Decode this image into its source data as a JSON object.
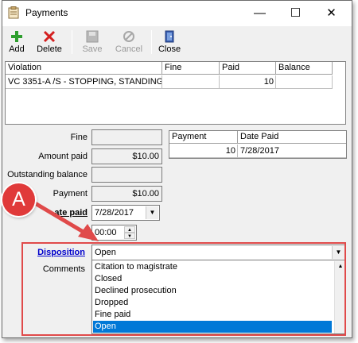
{
  "window": {
    "title": "Payments"
  },
  "window_controls": {
    "minimize": "—",
    "maximize": "☐",
    "close": "✕"
  },
  "toolbar": {
    "add": "Add",
    "delete": "Delete",
    "save": "Save",
    "cancel": "Cancel",
    "close": "Close"
  },
  "violations": {
    "headers": [
      "Violation",
      "Fine",
      "Paid",
      "Balance"
    ],
    "rows": [
      {
        "violation": "VC 3351-A /S - STOPPING, STANDING",
        "fine": "",
        "paid": "10",
        "balance": ""
      }
    ]
  },
  "form": {
    "fine_label": "Fine",
    "fine_value": "",
    "amount_paid_label": "Amount paid",
    "amount_paid_value": "$10.00",
    "outstanding_label": "Outstanding balance",
    "outstanding_value": "",
    "payment_label": "Payment",
    "payment_value": "$10.00",
    "date_paid_label": "Date paid",
    "date_paid_visible_label": "ate paid",
    "date_paid_value": "7/28/2017",
    "time_value": "00:00",
    "disposition_label": "Disposition",
    "disposition_value": "Open",
    "comments_label": "Comments"
  },
  "payments_grid": {
    "headers": [
      "Payment",
      "Date Paid"
    ],
    "rows": [
      {
        "payment": "10",
        "date_paid": "7/28/2017"
      }
    ]
  },
  "disposition_options": [
    "Citation to magistrate",
    "Closed",
    "Declined prosecution",
    "Dropped",
    "Fine paid",
    "Open"
  ],
  "disposition_selected": "Open",
  "callout": {
    "label": "A",
    "color": "#e03a3a"
  },
  "colors": {
    "accent": "#0078d7",
    "link": "#0000cc",
    "annotation": "#e04a4a"
  }
}
